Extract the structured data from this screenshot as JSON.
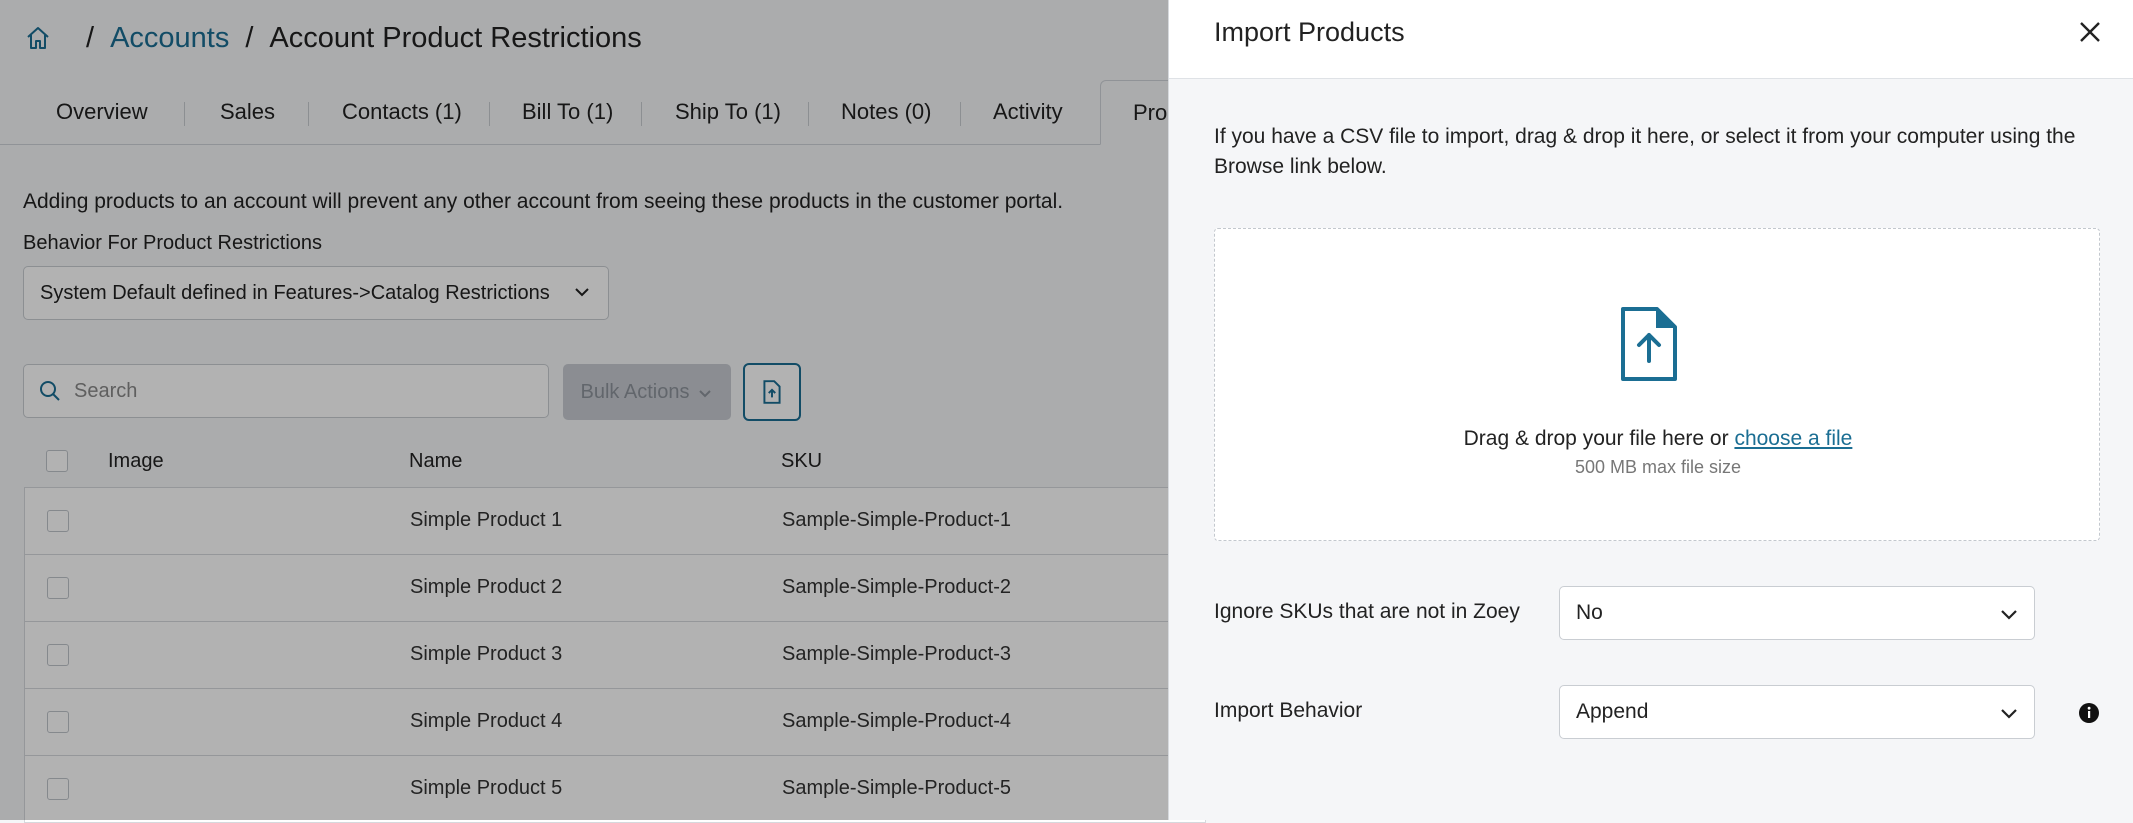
{
  "breadcrumb": {
    "home_icon": "home-icon",
    "separator": "/",
    "accounts": "Accounts",
    "current": "Account Product Restrictions"
  },
  "tabs": [
    {
      "label": "Overview"
    },
    {
      "label": "Sales"
    },
    {
      "label": "Contacts (1)"
    },
    {
      "label": "Bill To (1)"
    },
    {
      "label": "Ship To (1)"
    },
    {
      "label": "Notes (0)"
    },
    {
      "label": "Activity"
    },
    {
      "label": "Proc"
    }
  ],
  "restrictions": {
    "description": "Adding products to an account will prevent any other account from seeing these products in the customer portal.",
    "behavior_label": "Behavior For Product Restrictions",
    "behavior_value": "System Default defined in Features->Catalog Restrictions"
  },
  "toolbar": {
    "search_placeholder": "Search",
    "bulk_actions": "Bulk Actions"
  },
  "table": {
    "headers": {
      "image": "Image",
      "name": "Name",
      "sku": "SKU"
    },
    "rows": [
      {
        "name": "Simple Product 1",
        "sku": "Sample-Simple-Product-1"
      },
      {
        "name": "Simple Product 2",
        "sku": "Sample-Simple-Product-2"
      },
      {
        "name": "Simple Product 3",
        "sku": "Sample-Simple-Product-3"
      },
      {
        "name": "Simple Product 4",
        "sku": "Sample-Simple-Product-4"
      },
      {
        "name": "Simple Product 5",
        "sku": "Sample-Simple-Product-5"
      }
    ]
  },
  "drawer": {
    "title": "Import Products",
    "intro": "If you have a CSV file to import, drag & drop it here, or select it from your computer using the Browse link below.",
    "dropzone": {
      "text": "Drag & drop your file here or ",
      "link": "choose a file",
      "size_note": "500 MB max file size"
    },
    "ignore_skus": {
      "label": "Ignore SKUs that are not in Zoey",
      "value": "No"
    },
    "import_behavior": {
      "label": "Import Behavior",
      "value": "Append"
    }
  },
  "colors": {
    "accent": "#1b6e93",
    "overlay": "rgba(0,0,0,0.30)"
  }
}
